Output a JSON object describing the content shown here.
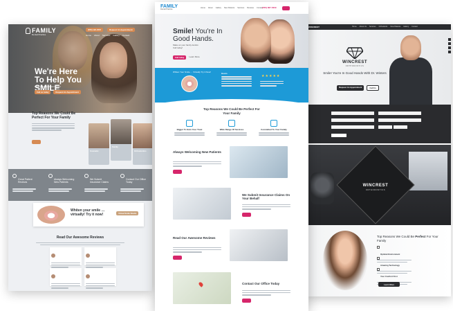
{
  "left": {
    "logo_name": "FAMILY",
    "logo_sub": "Dental Practice",
    "top_btn1": "(555) 123-4567",
    "top_btn2": "Request An Appointment",
    "nav": [
      "Home",
      "About",
      "Services",
      "Gallery",
      "Contact"
    ],
    "hero_heading": "We're Here To Help You SMILE",
    "hero_sub": "Make an appointment today!",
    "hero_btn1": "Call us today",
    "hero_btn2": "Request An Appointment",
    "reasons_title": "Top Reasons We Could Be Perfect For Your Family",
    "cards": [
      "Cosmetic",
      "Family",
      "Orthodontics"
    ],
    "band_items": [
      "Great Patient Reviews",
      "Always Welcoming New Patients",
      "We Submit Insurance Claims",
      "Contact Our Office Today"
    ],
    "smile_text": "Whiten your smile … virtually! Try it now!",
    "smile_btn": "Virtual Smile Studio",
    "reviews_title": "Read Our Awesome Reviews"
  },
  "center": {
    "logo_name": "FAMILY",
    "logo_sub": "Dental Practice",
    "nav": [
      "Home",
      "About",
      "Gallery",
      "New Patients",
      "Services",
      "Reviews",
      "Contact"
    ],
    "phone": "(555) 867-5309",
    "hero_bold": "Smile!",
    "hero_line1": " You're In",
    "hero_line2": "Good Hands.",
    "hero_sub": "Make an your family dentist.",
    "hero_sub2": "Call today!",
    "hero_btn": "Call today",
    "hero_link": "Learn More",
    "band_label": "Whiten Your Smile … Virtually Try It Now!",
    "band_hours_title": "Hours",
    "stars": "★★★★★",
    "section_title": "Top Reasons We Could Be Perfect For Your Family",
    "features": [
      "Bigger To Earn Your Trust",
      "Wide Range Of Services",
      "Committed To Your Family"
    ],
    "rows": [
      {
        "title": "Always Welcoming New Patients"
      },
      {
        "title": "We Submit Insurance Claims On Your Behalf"
      },
      {
        "title": "Read Our Awesome Reviews"
      },
      {
        "title": "Contact Our Office Today"
      }
    ],
    "colors": {
      "accent": "#1d9ad7",
      "button": "#d6266b"
    }
  },
  "right": {
    "logo": "WINCREST",
    "nav": [
      "Home",
      "About Us",
      "Services",
      "Orthodontic",
      "New Patients",
      "Gallery",
      "Contact"
    ],
    "brand": "WINCREST",
    "brand_sub": "ORTHODONTICS",
    "hero_heading": "Smile! You're In Good Hands With Dr. Winters",
    "hero_btn1": "Request An Appointment",
    "hero_btn2": "Call Us",
    "sign_text": "WINCREST",
    "sign_sub": "ORTHODONTICS",
    "bottom_heading_a": "Top Reasons We Could Be ",
    "bottom_heading_bold": "Perfect",
    "bottom_heading_b": " For Your Family",
    "bottom_items": [
      "Optimal Environment",
      "Amazing Technology",
      "Your Comfort First"
    ],
    "bottom_btn": "Learn More"
  }
}
